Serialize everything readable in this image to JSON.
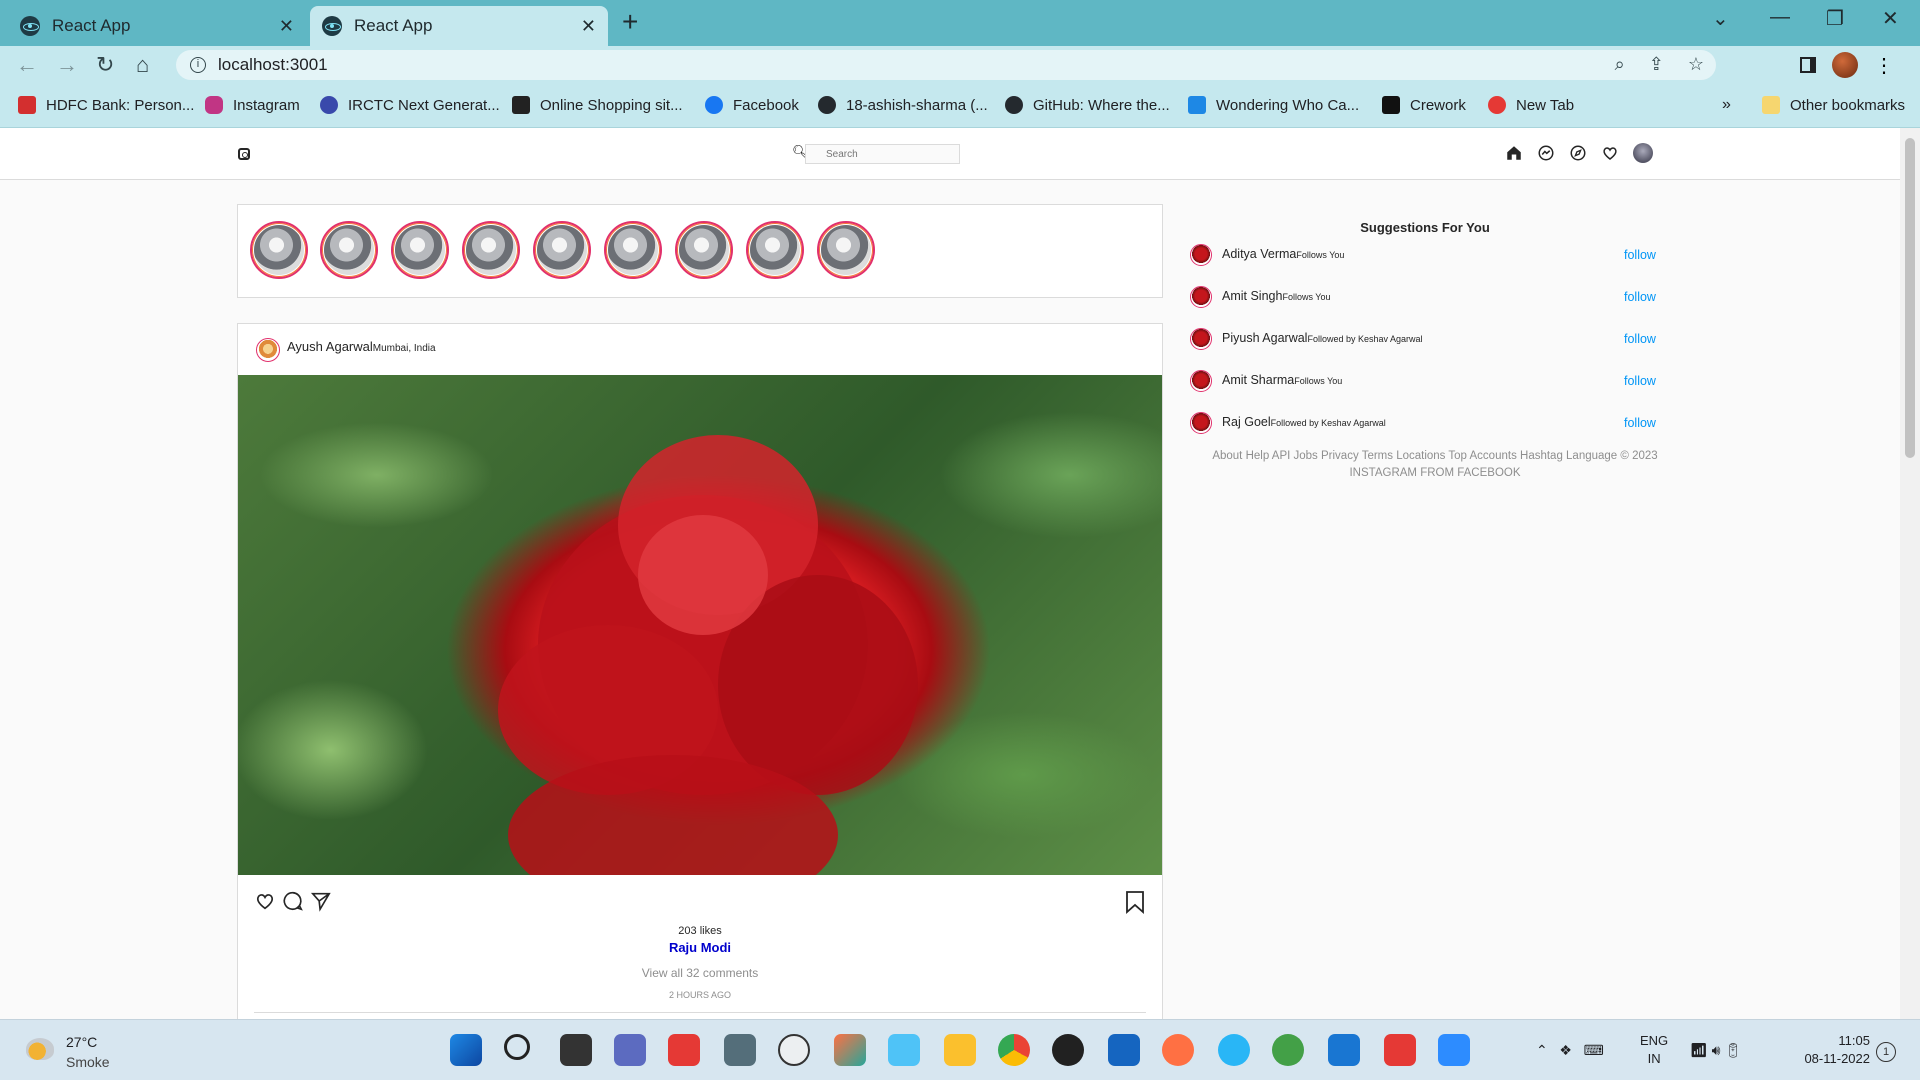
{
  "browser": {
    "tabs": [
      {
        "title": "React App",
        "active": false
      },
      {
        "title": "React App",
        "active": true
      }
    ],
    "url": "localhost:3001",
    "bookmarks": [
      {
        "label": "HDFC Bank: Person...",
        "icon_color": "#d32f2f"
      },
      {
        "label": "Instagram",
        "icon_color": "#c13584"
      },
      {
        "label": "IRCTC Next Generat...",
        "icon_color": "#3949ab"
      },
      {
        "label": "Online Shopping sit...",
        "icon_color": "#222222"
      },
      {
        "label": "Facebook",
        "icon_color": "#1877f2"
      },
      {
        "label": "18-ashish-sharma (...",
        "icon_color": "#24292e"
      },
      {
        "label": "GitHub: Where the...",
        "icon_color": "#24292e"
      },
      {
        "label": "Wondering Who Ca...",
        "icon_color": "#1e88e5"
      },
      {
        "label": "Crework",
        "icon_color": "#111111"
      },
      {
        "label": "New Tab",
        "icon_color": "#e53935"
      }
    ],
    "bookmarks_more": "»",
    "other_bookmarks": "Other bookmarks"
  },
  "app": {
    "search_placeholder": "Search",
    "stories_count": 9,
    "post": {
      "author": "Ayush Agarwal",
      "location": "Mumbai, India",
      "likes": "203 likes",
      "caption_user": "Raju Modi",
      "view_comments": "View all 32 comments",
      "timestamp": "2 HOURS AGO"
    },
    "suggestions": {
      "title": "Suggestions For You",
      "items": [
        {
          "name": "Aditya Verma",
          "sub": "Follows You",
          "action": "follow"
        },
        {
          "name": "Amit Singh",
          "sub": "Follows You",
          "action": "follow"
        },
        {
          "name": "Piyush Agarwal",
          "sub": "Followed by Keshav Agarwal",
          "action": "follow"
        },
        {
          "name": "Amit Sharma",
          "sub": "Follows You",
          "action": "follow"
        },
        {
          "name": "Raj Goel",
          "sub": "Followed by Keshav Agarwal",
          "action": "follow"
        }
      ]
    },
    "footer": "About Help API Jobs Privacy Terms Locations Top Accounts Hashtag Language © 2023 INSTAGRAM FROM FACEBOOK"
  },
  "taskbar": {
    "weather_temp": "27°C",
    "weather_cond": "Smoke",
    "lang_top": "ENG",
    "lang_bottom": "IN",
    "time": "11:05",
    "date": "08-11-2022",
    "notifications": "1"
  }
}
